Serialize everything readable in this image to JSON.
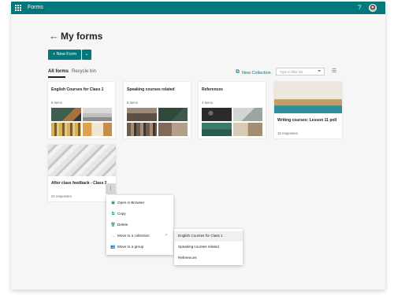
{
  "header": {
    "app_name": "Forms",
    "help_label": "?",
    "colors": {
      "brand": "#03787c",
      "text": "#222222"
    }
  },
  "page": {
    "back_icon": "←",
    "title": "My forms",
    "new_form_label": "+ New Form",
    "new_form_dropdown_icon": "⌄"
  },
  "tabs": [
    {
      "label": "All forms",
      "active": true
    },
    {
      "label": "Recycle bin",
      "active": false
    }
  ],
  "toolbar": {
    "new_collection_label": "New Collection",
    "new_collection_icon": "⧉",
    "search_placeholder": "Type to filter list",
    "filter_icon": "⏷",
    "view_icon": "☰"
  },
  "cards": [
    {
      "title": "English Courses for Class 1",
      "meta": "6 items",
      "type": "collection"
    },
    {
      "title": "Speaking courses related",
      "meta": "5 items",
      "type": "collection"
    },
    {
      "title": "References",
      "meta": "4 items",
      "type": "collection"
    },
    {
      "title": "Writing courses: Lesson 11 poll",
      "meta": "10 responses",
      "type": "form"
    },
    {
      "title": "After class feedback - Class 2",
      "meta": "24 responses",
      "type": "form"
    }
  ],
  "more_icon": "⋮",
  "context_menu": {
    "items": [
      {
        "label": "Open in Browser",
        "icon": "▣",
        "has_submenu": false
      },
      {
        "label": "Copy",
        "icon": "⧉",
        "has_submenu": false
      },
      {
        "label": "Delete",
        "icon": "🗑",
        "has_submenu": false
      },
      {
        "label": "Move to a collection",
        "icon": "→",
        "has_submenu": true
      },
      {
        "label": "Move to a group",
        "icon": "👥",
        "has_submenu": false
      }
    ],
    "submenu_arrow": "›"
  },
  "collection_submenu": {
    "items": [
      {
        "label": "English Courses for Class 1",
        "highlighted": true
      },
      {
        "label": "Speaking courses related",
        "highlighted": false
      },
      {
        "label": "References",
        "highlighted": false
      }
    ]
  }
}
